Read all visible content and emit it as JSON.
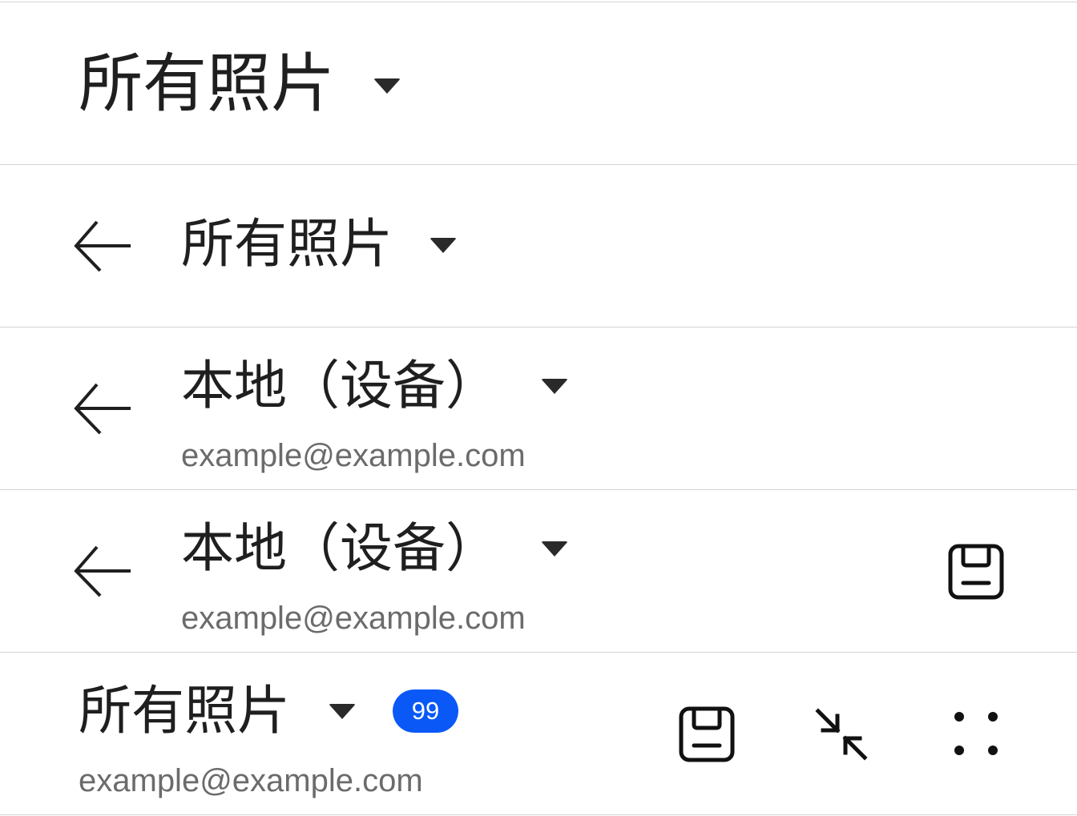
{
  "bars": [
    {
      "title": "所有照片"
    },
    {
      "title": "所有照片"
    },
    {
      "title": "本地（设备）",
      "subtitle": "example@example.com"
    },
    {
      "title": "本地（设备）",
      "subtitle": "example@example.com"
    },
    {
      "title": "所有照片",
      "subtitle": "example@example.com",
      "badge": "99"
    }
  ],
  "icons": {
    "back": "back-arrow-icon",
    "dropdown": "caret-down-icon",
    "save": "save-icon",
    "collapse": "collapse-icon",
    "more": "more-dots-icon"
  },
  "colors": {
    "badge": "#0a59f7",
    "divider": "#d4d4d4",
    "subtitle": "#6b6b6b"
  }
}
